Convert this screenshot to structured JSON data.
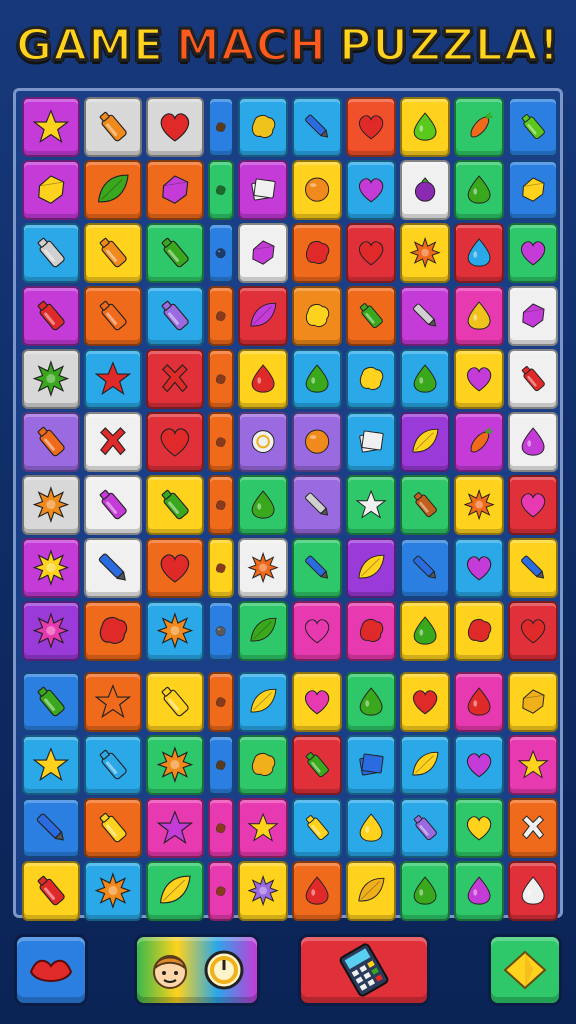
{
  "title": {
    "words": [
      {
        "text": "GAME",
        "color": "#ffd21e"
      },
      {
        "text": "MACH",
        "color": "#ff5a1e"
      },
      {
        "text": "PUZZLA!",
        "color": "#ffd21e"
      }
    ]
  },
  "board": {
    "rows": [
      [
        [
          "#c43bd8",
          "star",
          "#ffd21e"
        ],
        [
          "#d8d8d8",
          "bottle",
          "#f08a1c"
        ],
        [
          "#d8d8d8",
          "heart",
          "#e02a2a"
        ],
        [
          "#2a7fe0",
          "blob",
          "#5a3b1c"
        ],
        [
          "#2aa8e8",
          "blob",
          "#f0c21c"
        ],
        [
          "#2aa8e8",
          "pen",
          "#2a6ce0"
        ],
        [
          "#f0502a",
          "heart",
          "#e02a2a"
        ],
        [
          "#ffd21e",
          "drop",
          "#5ac81c"
        ],
        [
          "#2ec86a",
          "carrot",
          "#f06a1c"
        ],
        [
          "#2a7fe0",
          "bottle",
          "#5ac81c"
        ]
      ],
      [
        [
          "#c43bd8",
          "gem",
          "#ffd21e"
        ],
        [
          "#f06a1c",
          "leaf",
          "#3aa81c"
        ],
        [
          "#f06a1c",
          "gem",
          "#c43bd8"
        ],
        [
          "#2ec86a",
          "blob",
          "#1c6a2a"
        ],
        [
          "#c43bd8",
          "card",
          "#f0f0f0"
        ],
        [
          "#ffd21e",
          "circle",
          "#f08a1c"
        ],
        [
          "#2aa8e8",
          "heart",
          "#c43bd8"
        ],
        [
          "#f0f0f0",
          "berry",
          "#8a2ab0"
        ],
        [
          "#2ec86a",
          "drop",
          "#3aa81c"
        ],
        [
          "#2a7fe0",
          "gem",
          "#ffd21e"
        ]
      ],
      [
        [
          "#2aa8e8",
          "bottle",
          "#d0d0d0"
        ],
        [
          "#ffd21e",
          "bottle",
          "#f08a1c"
        ],
        [
          "#2ec86a",
          "bottle",
          "#3aa81c"
        ],
        [
          "#2a7fe0",
          "circle",
          "#1c3a6a"
        ],
        [
          "#f0f0f0",
          "gem",
          "#c43bd8"
        ],
        [
          "#f06a1c",
          "blob",
          "#e02a2a"
        ],
        [
          "#e0303a",
          "heart",
          "#e02a2a"
        ],
        [
          "#ffd21e",
          "burst",
          "#f06a1c"
        ],
        [
          "#e0303a",
          "drop",
          "#2aa8e8"
        ],
        [
          "#2ec86a",
          "heart",
          "#c43bd8"
        ]
      ],
      [
        [
          "#c43bd8",
          "bottle",
          "#e02a2a"
        ],
        [
          "#f06a1c",
          "bottle",
          "#f06a1c"
        ],
        [
          "#2aa8e8",
          "bottle",
          "#9a6ae0"
        ],
        [
          "#f06a1c",
          "blob",
          "#8a3a1c"
        ],
        [
          "#e0303a",
          "leaf",
          "#c43bd8"
        ],
        [
          "#f08a1c",
          "blob",
          "#ffd21e"
        ],
        [
          "#f06a1c",
          "bottle",
          "#3aa81c"
        ],
        [
          "#c43bd8",
          "pen",
          "#d0d0d0"
        ],
        [
          "#e83ab0",
          "drop",
          "#f0c21c"
        ],
        [
          "#f0f0f0",
          "gem",
          "#c43bd8"
        ]
      ],
      [
        [
          "#d8d8d8",
          "burst",
          "#3aa81c"
        ],
        [
          "#2aa8e8",
          "star",
          "#e02a2a"
        ],
        [
          "#e0303a",
          "cross",
          "#e02a2a"
        ],
        [
          "#f06a1c",
          "blob",
          "#8a3a1c"
        ],
        [
          "#ffd21e",
          "drop",
          "#e02a2a"
        ],
        [
          "#2aa8e8",
          "drop",
          "#3aa81c"
        ],
        [
          "#2aa8e8",
          "blob",
          "#ffd21e"
        ],
        [
          "#2aa8e8",
          "drop",
          "#3aa81c"
        ],
        [
          "#ffd21e",
          "heart",
          "#c43bd8"
        ],
        [
          "#f0f0f0",
          "bottle",
          "#e02a2a"
        ]
      ],
      [
        [
          "#9a6ae0",
          "bottle",
          "#f06a1c"
        ],
        [
          "#f0f0f0",
          "cross",
          "#e02a2a"
        ],
        [
          "#e0303a",
          "heart",
          "#e02a2a"
        ],
        [
          "#f06a1c",
          "blob",
          "#8a3a1c"
        ],
        [
          "#9a6ae0",
          "ring",
          "#f0f0f0"
        ],
        [
          "#9a6ae0",
          "circle",
          "#f08a1c"
        ],
        [
          "#2aa8e8",
          "card",
          "#f0f0f0"
        ],
        [
          "#9a3ad8",
          "leaf",
          "#ffd21e"
        ],
        [
          "#c43bd8",
          "carrot",
          "#f06a1c"
        ],
        [
          "#f0f0f0",
          "drop",
          "#c43bd8"
        ]
      ],
      [
        [
          "#d8d8d8",
          "burst",
          "#f08a1c"
        ],
        [
          "#f0f0f0",
          "bottle",
          "#c43bd8"
        ],
        [
          "#ffd21e",
          "bottle",
          "#3aa81c"
        ],
        [
          "#f06a1c",
          "blob",
          "#8a3a1c"
        ],
        [
          "#2ec86a",
          "drop",
          "#3aa81c"
        ],
        [
          "#9a6ae0",
          "pen",
          "#d0d0d0"
        ],
        [
          "#2ec86a",
          "star",
          "#f0f0f0"
        ],
        [
          "#2ec86a",
          "bottle",
          "#c0601c"
        ],
        [
          "#ffd21e",
          "burst",
          "#f06a1c"
        ],
        [
          "#e0303a",
          "heart",
          "#e83ab0"
        ]
      ],
      [
        [
          "#c43bd8",
          "burst",
          "#ffd21e"
        ],
        [
          "#f0f0f0",
          "pen",
          "#2a6ce0"
        ],
        [
          "#f06a1c",
          "heart",
          "#e02a2a"
        ],
        [
          "#ffd21e",
          "blob",
          "#8a3a1c"
        ],
        [
          "#f0f0f0",
          "burst",
          "#f06a1c"
        ],
        [
          "#2ec86a",
          "pen",
          "#2a6ce0"
        ],
        [
          "#9a3ad8",
          "leaf",
          "#ffd21e"
        ],
        [
          "#2a7fe0",
          "pen",
          "#2a6ce0"
        ],
        [
          "#2aa8e8",
          "heart",
          "#c43bd8"
        ],
        [
          "#ffd21e",
          "pen",
          "#2a6ce0"
        ]
      ],
      [
        [
          "#9a3ad8",
          "burst",
          "#e83ab0"
        ],
        [
          "#f06a1c",
          "blob",
          "#e02a2a"
        ],
        [
          "#2aa8e8",
          "burst",
          "#f08a1c"
        ],
        [
          "#2a7fe0",
          "circle",
          "#5a5a5a"
        ],
        [
          "#2ec86a",
          "leaf",
          "#3aa81c"
        ],
        [
          "#e83ab0",
          "heart",
          "#e83ab0"
        ],
        [
          "#e83ab0",
          "blob",
          "#e02a2a"
        ],
        [
          "#ffd21e",
          "drop",
          "#3aa81c"
        ],
        [
          "#ffd21e",
          "blob",
          "#e02a2a"
        ],
        [
          "#e0303a",
          "heart",
          "#e02a2a"
        ]
      ],
      [
        [
          "#2a7fe0",
          "bottle",
          "#3aa81c"
        ],
        [
          "#f06a1c",
          "star",
          "#f06a1c"
        ],
        [
          "#ffd21e",
          "bottle",
          "#ffd21e"
        ],
        [
          "#f06a1c",
          "blob",
          "#8a3a1c"
        ],
        [
          "#2aa8e8",
          "leaf",
          "#ffd21e"
        ],
        [
          "#ffd21e",
          "heart",
          "#e83ab0"
        ],
        [
          "#2ec86a",
          "drop",
          "#3aa81c"
        ],
        [
          "#ffd21e",
          "heart",
          "#e02a2a"
        ],
        [
          "#e83ab0",
          "drop",
          "#e02a2a"
        ],
        [
          "#ffd21e",
          "gem",
          "#f0b01c"
        ]
      ],
      [
        [
          "#2aa8e8",
          "star",
          "#ffd21e"
        ],
        [
          "#2aa8e8",
          "bottle",
          "#2aa8e8"
        ],
        [
          "#2ec86a",
          "burst",
          "#f08a1c"
        ],
        [
          "#2a7fe0",
          "blob",
          "#5a3b1c"
        ],
        [
          "#2ec86a",
          "blob",
          "#f0b01c"
        ],
        [
          "#e0303a",
          "bottle",
          "#3aa81c"
        ],
        [
          "#2aa8e8",
          "card",
          "#2a6ce0"
        ],
        [
          "#2aa8e8",
          "leaf",
          "#ffd21e"
        ],
        [
          "#2aa8e8",
          "heart",
          "#c43bd8"
        ],
        [
          "#e83ab0",
          "star",
          "#ffd21e"
        ]
      ],
      [
        [
          "#2a7fe0",
          "pen",
          "#2a6ce0"
        ],
        [
          "#f06a1c",
          "bottle",
          "#ffd21e"
        ],
        [
          "#e83ab0",
          "star",
          "#c43bd8"
        ],
        [
          "#e83ab0",
          "blob",
          "#8a3a1c"
        ],
        [
          "#e83ab0",
          "star",
          "#ffd21e"
        ],
        [
          "#2aa8e8",
          "bottle",
          "#ffd21e"
        ],
        [
          "#2aa8e8",
          "drop",
          "#ffd21e"
        ],
        [
          "#2aa8e8",
          "bottle",
          "#9a6ae0"
        ],
        [
          "#2ec86a",
          "heart",
          "#ffd21e"
        ],
        [
          "#f06a1c",
          "cross",
          "#f0f0f0"
        ]
      ],
      [
        [
          "#ffd21e",
          "bottle",
          "#e02a2a"
        ],
        [
          "#2aa8e8",
          "burst",
          "#f08a1c"
        ],
        [
          "#2ec86a",
          "leaf",
          "#ffd21e"
        ],
        [
          "#e83ab0",
          "blob",
          "#8a3a1c"
        ],
        [
          "#ffd21e",
          "burst",
          "#9a6ae0"
        ],
        [
          "#f06a1c",
          "drop",
          "#e02a2a"
        ],
        [
          "#ffd21e",
          "leaf",
          "#f0b01c"
        ],
        [
          "#2ec86a",
          "drop",
          "#3aa81c"
        ],
        [
          "#2ec86a",
          "drop",
          "#c43bd8"
        ],
        [
          "#e0303a",
          "drop",
          "#f0f0f0"
        ]
      ]
    ]
  },
  "buttons": {
    "left": {
      "color": "#2a7fe0",
      "icon": "lips-icon"
    },
    "character": {
      "icon_face": "face-icon",
      "icon_timer": "timer-icon"
    },
    "phone": {
      "color": "#e0303a",
      "icon": "calculator-icon"
    },
    "right": {
      "color": "#2ec86a",
      "icon": "gem-icon"
    }
  }
}
